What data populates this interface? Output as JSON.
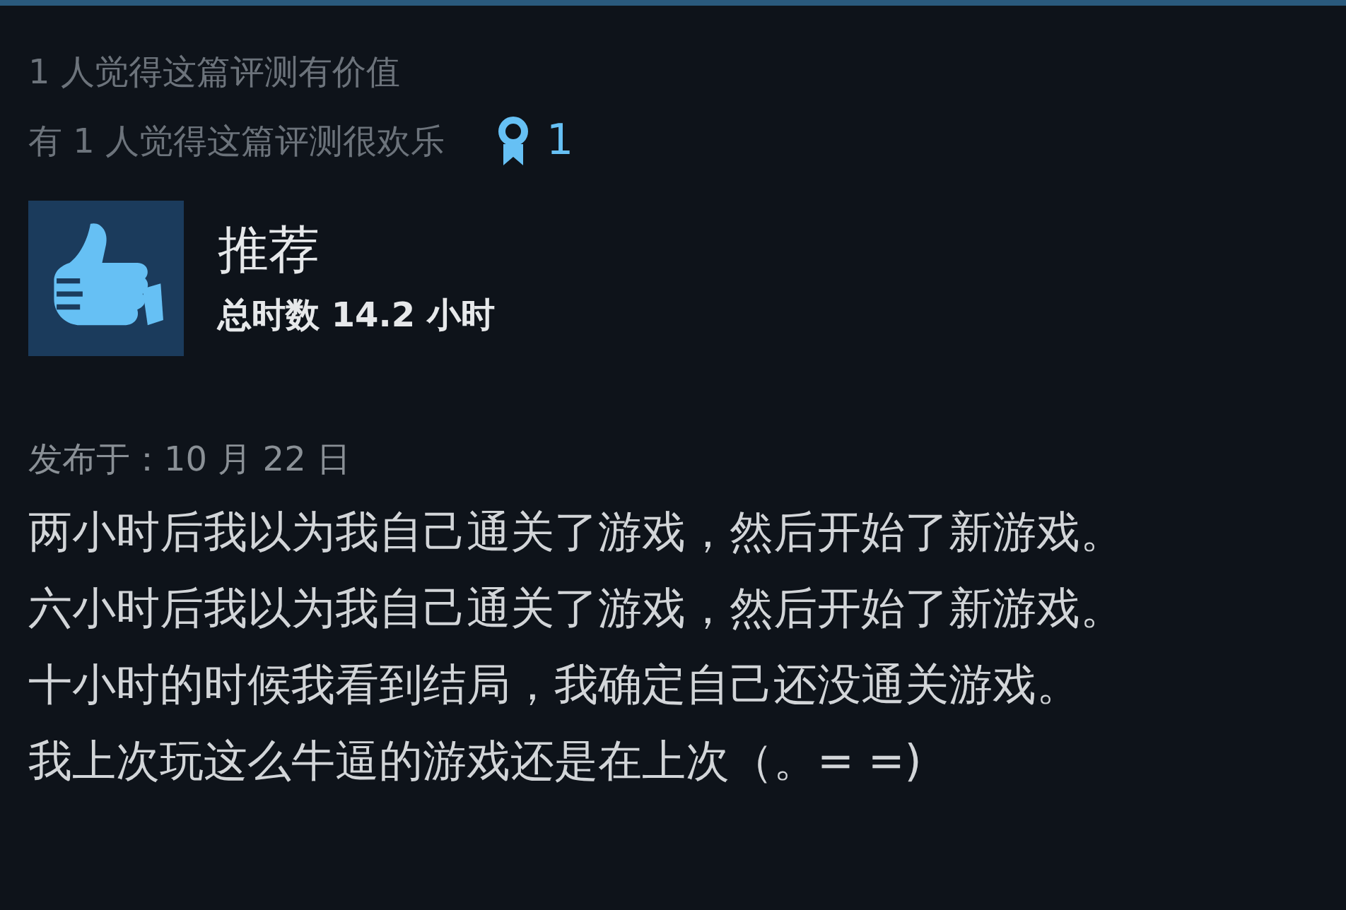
{
  "helpful": {
    "useful_text": "1 人觉得这篇评测有价值",
    "funny_text": "有 1 人觉得这篇评测很欢乐",
    "award_count": "1"
  },
  "verdict": {
    "kind": "recommended",
    "title": "推荐",
    "hours": "总时数 14.2 小时"
  },
  "posted": "发布于：10 月 22 日",
  "body": [
    "两小时后我以为我自己通关了游戏，然后开始了新游戏。",
    "六小时后我以为我自己通关了游戏，然后开始了新游戏。",
    "十小时的时候我看到结局，我确定自己还没通关游戏。",
    "我上次玩这么牛逼的游戏还是在上次（。= =)"
  ]
}
